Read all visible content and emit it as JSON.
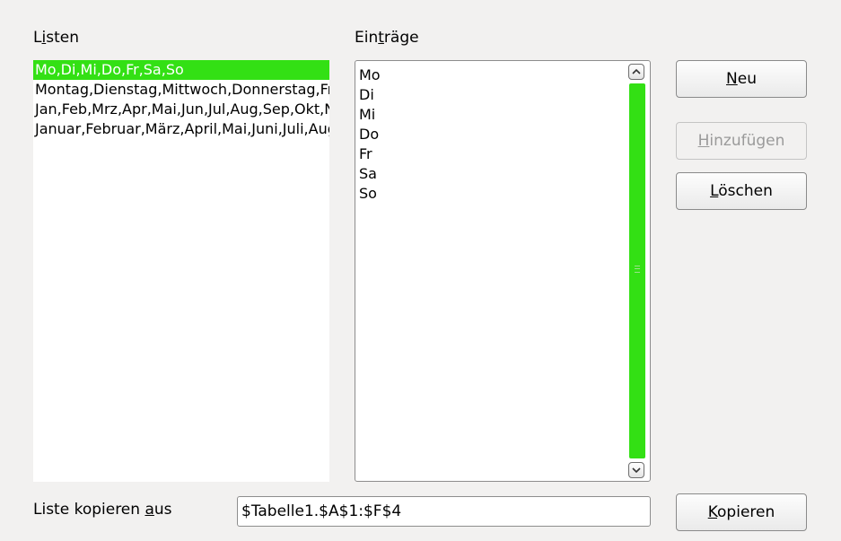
{
  "lists": {
    "label_pre": "L",
    "label_mnemonic": "i",
    "label_post": "sten",
    "items": [
      "Mo,Di,Mi,Do,Fr,Sa,So",
      "Montag,Dienstag,Mittwoch,Donnerstag,Freitag,Samstag,Sonntag",
      "Jan,Feb,Mrz,Apr,Mai,Jun,Jul,Aug,Sep,Okt,Nov,Dez",
      "Januar,Februar,März,April,Mai,Juni,Juli,August,September,Oktober,November,Dezember"
    ],
    "selected_index": 0
  },
  "entries": {
    "label_pre": "Ein",
    "label_mnemonic": "t",
    "label_post": "räge",
    "lines": [
      "Mo",
      "Di",
      "Mi",
      "Do",
      "Fr",
      "Sa",
      "So"
    ]
  },
  "buttons": {
    "new": {
      "mnemonic": "N",
      "rest": "eu"
    },
    "add": {
      "mnemonic": "H",
      "rest": "inzufügen",
      "enabled": false
    },
    "delete": {
      "mnemonic": "L",
      "rest": "öschen"
    },
    "copy": {
      "mnemonic": "K",
      "rest": "opieren"
    }
  },
  "copy_from": {
    "label_pre": "Liste kopieren ",
    "label_mnemonic": "a",
    "label_post": "us",
    "value": "$Tabelle1.$A$1:$F$4"
  },
  "colors": {
    "selection": "#33e014",
    "scrollbar_thumb": "#33e014",
    "dialog_bg": "#f2f1f0"
  },
  "icons": {
    "scroll_up": "chevron-up-icon",
    "scroll_down": "chevron-down-icon"
  }
}
